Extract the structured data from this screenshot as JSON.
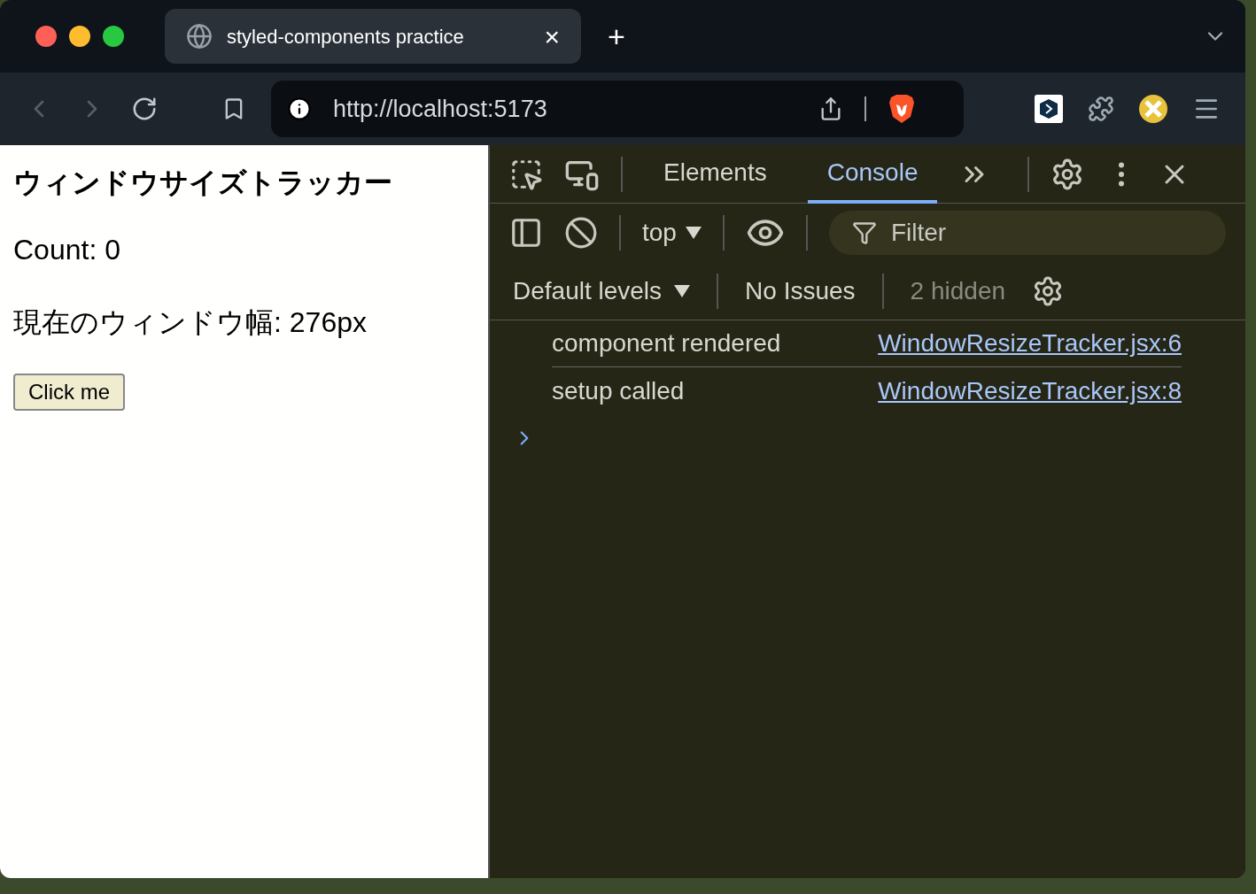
{
  "browser_tab": {
    "title": "styled-components practice",
    "close": "×",
    "new_tab": "+"
  },
  "address_bar": {
    "url": "http://localhost:5173"
  },
  "page": {
    "heading": "ウィンドウサイズトラッカー",
    "count": "Count: 0",
    "width": "現在のウィンドウ幅: 276px",
    "button": "Click me"
  },
  "devtools": {
    "tabs": [
      {
        "label": "Elements",
        "selected": false
      },
      {
        "label": "Console",
        "selected": true
      }
    ],
    "context": "top",
    "filter": {
      "placeholder": "Filter"
    },
    "levels": "Default levels",
    "issues": "No Issues",
    "hidden": "2 hidden",
    "messages": [
      {
        "text": "component rendered",
        "source": "WindowResizeTracker.jsx:6"
      },
      {
        "text": "setup called",
        "source": "WindowResizeTracker.jsx:8"
      }
    ]
  }
}
